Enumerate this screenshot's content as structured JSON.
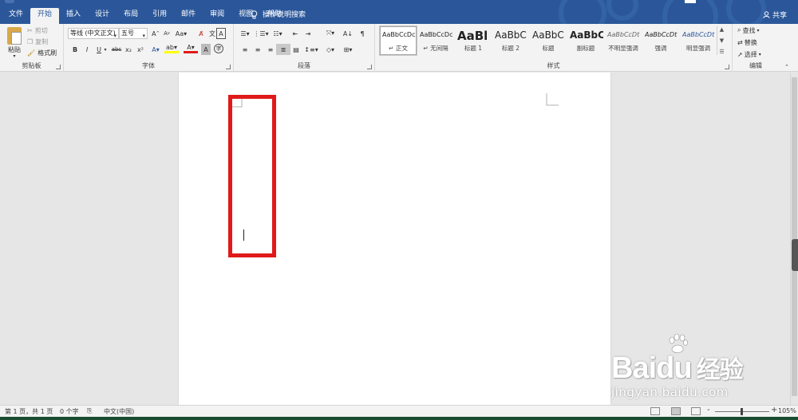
{
  "tabs": [
    "文件",
    "开始",
    "插入",
    "设计",
    "布局",
    "引用",
    "邮件",
    "审阅",
    "视图",
    "帮助"
  ],
  "active_tab_index": 1,
  "tell_me": "操作说明搜索",
  "share": "共享",
  "clipboard": {
    "paste": "粘贴",
    "cut": "剪切",
    "copy": "复制",
    "format_painter": "格式刷",
    "group_label": "剪贴板"
  },
  "font": {
    "font_name": "等线 (中文正文)",
    "font_size": "五号",
    "group_label": "字体",
    "row2": [
      "B",
      "I",
      "U",
      "abc",
      "x₂",
      "x²"
    ]
  },
  "paragraph": {
    "group_label": "段落"
  },
  "styles": {
    "group_label": "样式",
    "items": [
      {
        "sample": "AaBbCcDc",
        "name": "正文",
        "selected": true
      },
      {
        "sample": "AaBbCcDc",
        "name": "无间隔"
      },
      {
        "sample": "AaBl",
        "name": "标题 1"
      },
      {
        "sample": "AaBbC",
        "name": "标题 2"
      },
      {
        "sample": "AaBbC",
        "name": "标题"
      },
      {
        "sample": "AaBbC",
        "name": "副标题"
      },
      {
        "sample": "AaBbCcDt",
        "name": "不明显强调"
      },
      {
        "sample": "AaBbCcDt",
        "name": "强调"
      },
      {
        "sample": "AaBbCcDt",
        "name": "明显强调"
      }
    ]
  },
  "editing": {
    "group_label": "编辑",
    "find": "查找",
    "replace": "替换",
    "select": "选择"
  },
  "status": {
    "page": "第 1 页，共 1 页",
    "words": "0 个字",
    "language": "中文(中国)",
    "zoom": "105%",
    "zoom_minus": "-",
    "zoom_plus": "+"
  },
  "watermark": {
    "brand_main": "Bai",
    "brand_du": "du",
    "brand_cn": "经验",
    "url": "jingyan.baidu.com"
  },
  "colors": {
    "title_bar": "#2b579a",
    "ribbon": "#f3f3f3",
    "workspace": "#e6e6e6",
    "highlight_box": "#e01a1a"
  }
}
